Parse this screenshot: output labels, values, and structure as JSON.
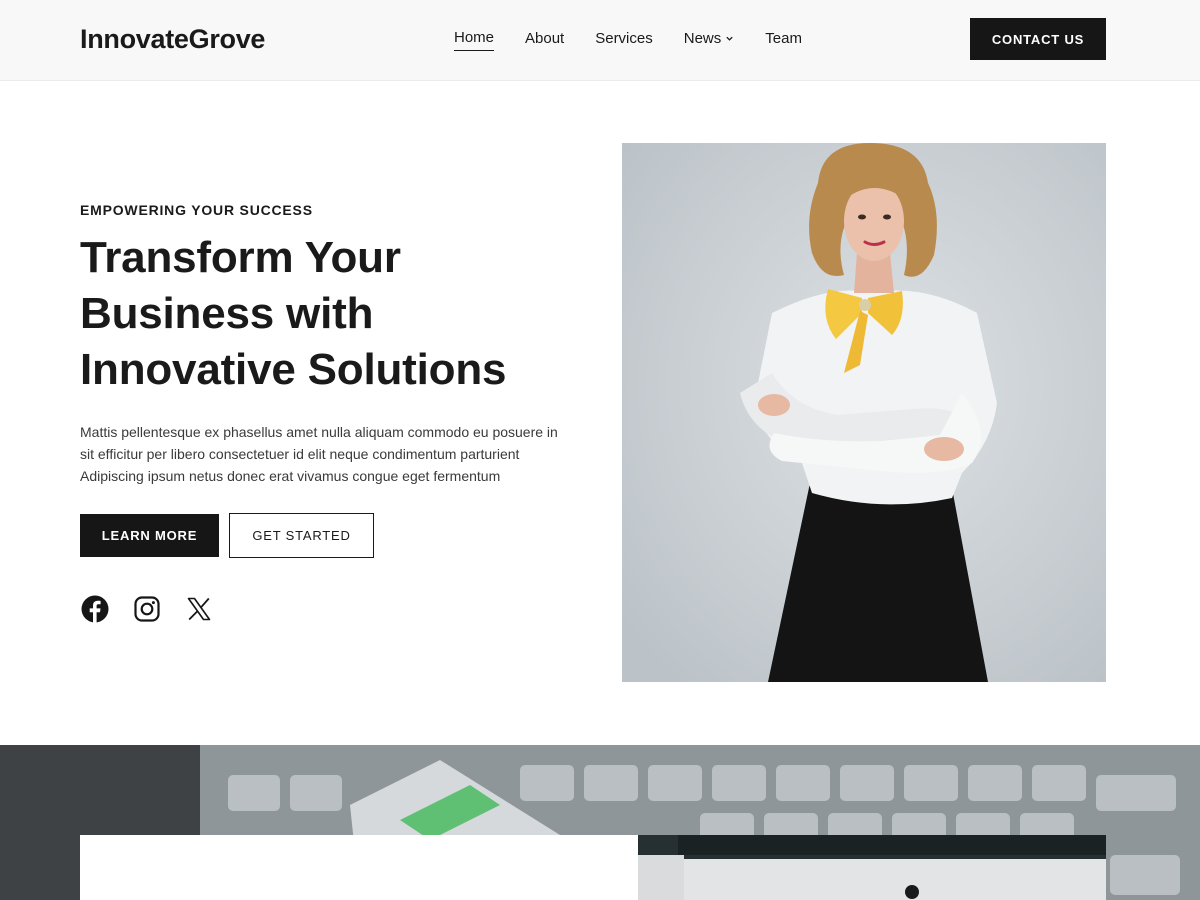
{
  "site": {
    "logo": "InnovateGrove"
  },
  "nav": {
    "items": [
      {
        "label": "Home",
        "active": true
      },
      {
        "label": "About",
        "active": false
      },
      {
        "label": "Services",
        "active": false
      },
      {
        "label": "News",
        "active": false,
        "dropdown": true
      },
      {
        "label": "Team",
        "active": false
      }
    ],
    "contact_label": "CONTACT US"
  },
  "hero": {
    "eyebrow": "EMPOWERING YOUR SUCCESS",
    "headline_lines": [
      "Transform Your",
      "Business with",
      "Innovative Solutions"
    ],
    "body_lines": [
      "Mattis pellentesque ex phasellus amet nulla aliquam commodo eu posuere in",
      "sit efficitur per libero consectetuer id elit neque condimentum parturient",
      "Adipiscing ipsum netus donec erat vivamus congue eget fermentum"
    ],
    "primary_button": "LEARN MORE",
    "secondary_button": "GET STARTED",
    "socials": [
      "facebook-icon",
      "instagram-icon",
      "x-icon"
    ]
  },
  "colors": {
    "dark": "#161616",
    "header_bg": "#f8f8f8",
    "band_bg": "#4a4d50",
    "accent_yellow": "#f5c842"
  }
}
